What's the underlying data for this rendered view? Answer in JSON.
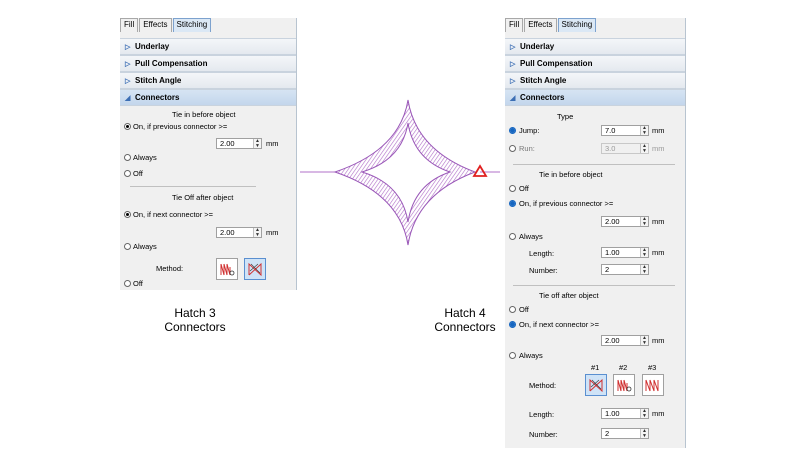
{
  "left_panel": {
    "tabs": [
      "Fill",
      "Effects",
      "Stitching"
    ],
    "sections": [
      "Underlay",
      "Pull Compensation",
      "Stitch Angle",
      "Connectors"
    ],
    "tie_in_title": "Tie in before object",
    "tie_in_option_on": "On, if previous connector >=",
    "tie_in_value": "2.00",
    "unit": "mm",
    "opt_always": "Always",
    "opt_off": "Off",
    "tie_off_title": "Tie Off after object",
    "tie_off_option_on": "On, if next connector >=",
    "tie_off_value": "2.00",
    "method_label": "Method:",
    "caption_line1": "Hatch 3",
    "caption_line2": "Connectors"
  },
  "right_panel": {
    "tabs": [
      "Fill",
      "Effects",
      "Stitching"
    ],
    "sections": [
      "Underlay",
      "Pull Compensation",
      "Stitch Angle",
      "Connectors"
    ],
    "type_title": "Type",
    "jump_label": "Jump:",
    "jump_value": "7.0",
    "run_label": "Run:",
    "run_value": "3.0",
    "unit": "mm",
    "tie_in_title": "Tie in before object",
    "opt_off": "Off",
    "tie_in_option_on": "On, if previous connector >=",
    "tie_in_value": "2.00",
    "opt_always": "Always",
    "length_label": "Length:",
    "length_value": "1.00",
    "number_label": "Number:",
    "number_value": "2",
    "tie_off_title": "Tie off after object",
    "tie_off_option_on": "On, if next connector >=",
    "tie_off_value": "2.00",
    "method_label": "Method:",
    "method_ids": [
      "#1",
      "#2",
      "#3"
    ],
    "length2_value": "1.00",
    "number2_value": "2",
    "caption_line1": "Hatch 4",
    "caption_line2": "Connectors"
  },
  "colors": {
    "stitch": "#b070c8",
    "marker": "#e02020",
    "accent": "#1565c0"
  },
  "icons": [
    "chevron-right-icon",
    "chevron-down-icon",
    "spin-arrows-icon",
    "tie-method-icon"
  ]
}
